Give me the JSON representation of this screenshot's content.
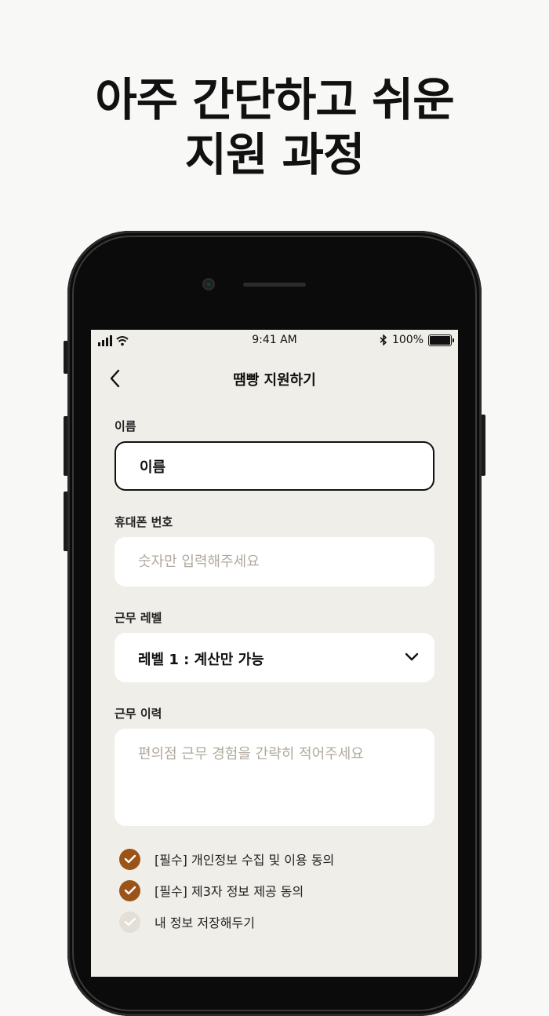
{
  "headline": {
    "line1": "아주 간단하고 쉬운",
    "line2": "지원 과정"
  },
  "status_bar": {
    "time": "9:41 AM",
    "battery": "100%",
    "icons": [
      "signal-icon",
      "wifi-icon",
      "bluetooth-icon",
      "battery-icon"
    ]
  },
  "nav": {
    "title": "땜빵 지원하기",
    "back_icon": "chevron-left-icon"
  },
  "form": {
    "name": {
      "label": "이름",
      "value": "이름"
    },
    "phone": {
      "label": "휴대폰 번호",
      "placeholder": "숫자만 입력해주세요"
    },
    "level": {
      "label": "근무 레벨",
      "value": "레벨 1 : 계산만 가능"
    },
    "history": {
      "label": "근무 이력",
      "placeholder": "편의점 근무 경험을 간략히 적어주세요"
    }
  },
  "agreements": [
    {
      "label": "[필수] 개인정보 수집 및 이용 동의",
      "checked": true
    },
    {
      "label": "[필수] 제3자 정보 제공 동의",
      "checked": true
    },
    {
      "label": "내 정보 저장해두기",
      "checked": false
    }
  ],
  "colors": {
    "accent": "#9b5317",
    "screen_bg": "#f0eee9",
    "placeholder": "#b1aa9e"
  }
}
